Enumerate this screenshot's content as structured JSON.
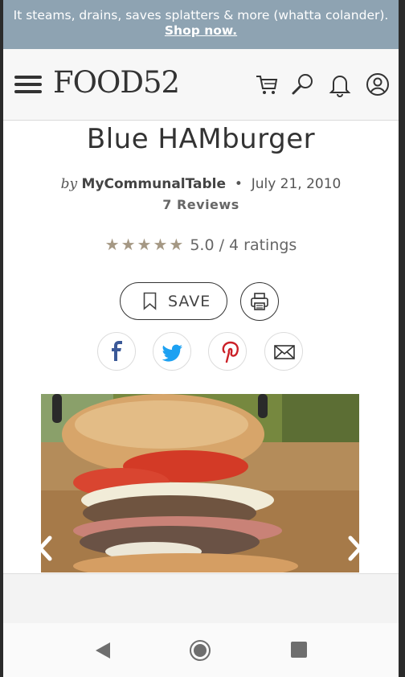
{
  "promo": {
    "text": "It steams, drains, saves splatters & more (whatta colander).",
    "link": "Shop now."
  },
  "header": {
    "logo": "FOOD52",
    "icons": [
      "menu-icon",
      "cart-icon",
      "search-icon",
      "bell-icon",
      "account-icon"
    ]
  },
  "recipe": {
    "title": "Blue HAMburger",
    "by": "by",
    "author": "MyCommunalTable",
    "separator": "•",
    "date": "July 21, 2010",
    "reviews": "7 Reviews",
    "stars": "★★★★★",
    "rating": "5.0 / 4 ratings"
  },
  "actions": {
    "save": "SAVE"
  },
  "share": [
    "facebook",
    "twitter",
    "pinterest",
    "email"
  ],
  "colors": {
    "promo_bg": "#8ea3b2",
    "star": "#a59884",
    "facebook": "#3b5998",
    "twitter": "#1da1f2",
    "pinterest": "#cb2027"
  }
}
